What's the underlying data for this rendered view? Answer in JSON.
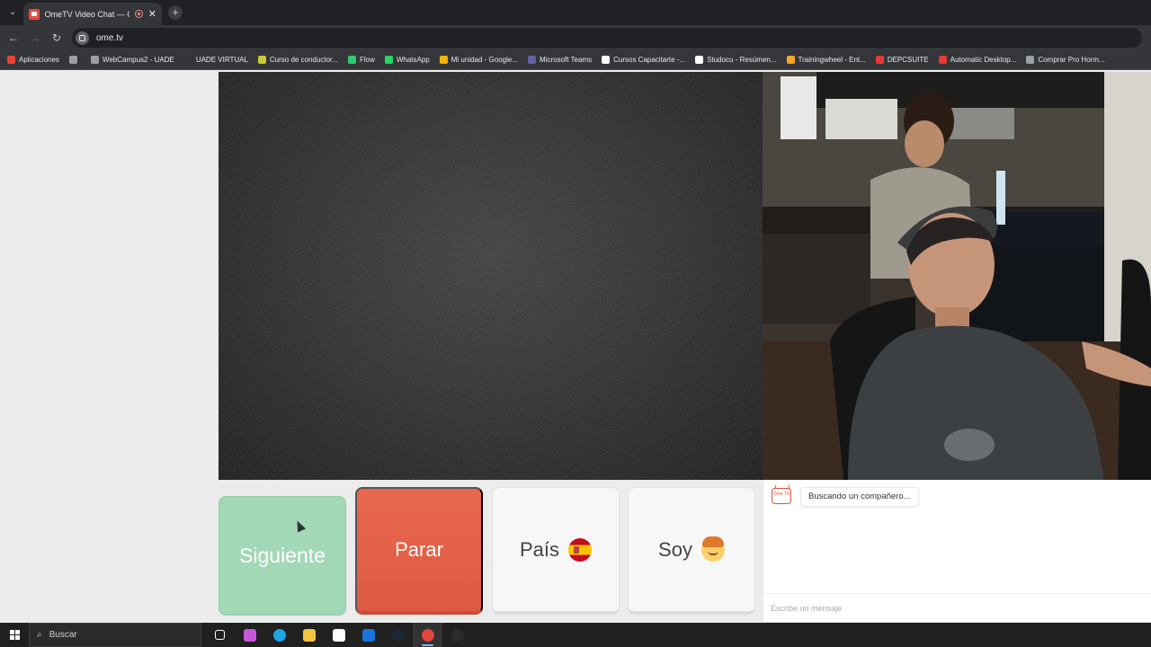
{
  "browser": {
    "tab": {
      "title": "OmeTV Video Chat — Ome"
    },
    "url": "ome.tv",
    "bookmarks": [
      {
        "label": "Aplicaciones",
        "icon": "apps-grid-icon",
        "color": "#e94235"
      },
      {
        "label": "",
        "icon": "grid-icon",
        "color": "#9aa0a6"
      },
      {
        "label": "WebCampus2 - UADE",
        "icon": "globe-icon",
        "color": "#9aa0a6"
      },
      {
        "label": "UADE VIRTUAL",
        "icon": "uade-icon",
        "color": "#35363a"
      },
      {
        "label": "Curso de conductor...",
        "icon": "folder-icon",
        "color": "#c9c93a"
      },
      {
        "label": "Flow",
        "icon": "flow-icon",
        "color": "#2ecc71"
      },
      {
        "label": "WhatsApp",
        "icon": "whatsapp-icon",
        "color": "#25d366"
      },
      {
        "label": "Mi unidad - Google...",
        "icon": "drive-icon",
        "color": "#f4b400"
      },
      {
        "label": "Microsoft Teams",
        "icon": "teams-icon",
        "color": "#6264a7"
      },
      {
        "label": "Cursos Capacitarte -...",
        "icon": "capacitarte-icon",
        "color": "#ffffff"
      },
      {
        "label": "Studocu - Resúmen...",
        "icon": "studocu-icon",
        "color": "#ffffff"
      },
      {
        "label": "Trainingwheel - Ent...",
        "icon": "trainingwheel-icon",
        "color": "#f5a623"
      },
      {
        "label": "DEPCSUITE",
        "icon": "depcsuite-icon",
        "color": "#e53935"
      },
      {
        "label": "Automatic Desktop...",
        "icon": "automatic-icon",
        "color": "#e53935"
      },
      {
        "label": "Comprar Pro Horm...",
        "icon": "tag-icon",
        "color": "#9aa0a6"
      }
    ]
  },
  "controls": {
    "next_label": "Siguiente",
    "stop_label": "Parar",
    "country_label": "País",
    "gender_label": "Soy"
  },
  "chat": {
    "status_message": "Buscando un compañero...",
    "input_placeholder": "Escribe un mensaje",
    "logo_text": "Ome TV"
  },
  "taskbar": {
    "search_placeholder": "Buscar",
    "apps": [
      {
        "icon": "task-view-icon",
        "color": "#ffffff",
        "active": false
      },
      {
        "icon": "copilot-icon",
        "color": "#c45ad8",
        "active": false
      },
      {
        "icon": "edge-icon",
        "color": "#1ea2e3",
        "active": false
      },
      {
        "icon": "file-explorer-icon",
        "color": "#f3c33c",
        "active": false
      },
      {
        "icon": "store-icon",
        "color": "#ffffff",
        "active": false
      },
      {
        "icon": "outlook-icon",
        "color": "#1a73d8",
        "active": false
      },
      {
        "icon": "steam-icon",
        "color": "#1b2838",
        "active": false
      },
      {
        "icon": "chrome-icon",
        "color": "#e2453c",
        "active": true
      },
      {
        "icon": "obs-icon",
        "color": "#2b2b2b",
        "active": false
      }
    ]
  },
  "colors": {
    "next_button": "#a3d8b7",
    "stop_button": "#e06049",
    "neutral_button": "#f7f7f7",
    "brand_red": "#e0503a"
  }
}
